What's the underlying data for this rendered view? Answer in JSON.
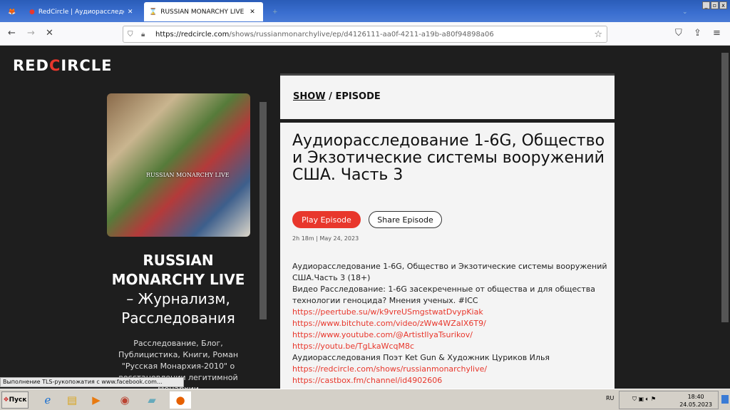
{
  "browser": {
    "tabs": [
      {
        "label": "RedCircle | Аудиорасследование",
        "icon": "redcircle-icon"
      },
      {
        "label": "RUSSIAN MONARCHY LIVE - Журн",
        "icon": "hourglass-icon",
        "active": true
      }
    ],
    "new_tab": "+",
    "url_host": "https://redcircle.com",
    "url_path": "/shows/russianmonarchylive/ep/d4126111-aa0f-4211-a19b-a80f94898a06",
    "status": "Выполнение TLS-рукопожатия с www.facebook.com..."
  },
  "page": {
    "logo_a": "RED",
    "logo_b": "CIRCLE",
    "cover_text": "RUSSIAN MONARCHY LIVE",
    "show_title_bold": "RUSSIAN MONARCHY LIVE",
    "show_title_rest": "– Журнализм, Расследования",
    "show_desc": "Расследование, Блог, Публицистика, Книги, Роман \"Русская Монархия-2010\" о восстановлении легитимной Монархии",
    "crumb_show": "SHOW",
    "crumb_sep": " / ",
    "crumb_episode": "EPISODE",
    "episode_title": "Аудиорасследование 1-6G, Общество и Экзотические системы вооружений США. Часть 3",
    "play_label": "Play Episode",
    "share_label": "Share Episode",
    "meta": "2h 18m | May 24, 2023",
    "desc": [
      {
        "text": "Аудиорасследование 1-6G, Общество и Экзотические системы вооружений США.Часть 3 (18+)"
      },
      {
        "text": "Видео Расследование: 1-6G засекреченные от общества и для общества технологии геноцида? Мнения ученых. #ICC"
      },
      {
        "link": "https://peertube.su/w/k9vreUSmgstwatDvypKiak"
      },
      {
        "link": "https://www.bitchute.com/video/zWw4WZaIX6T9/"
      },
      {
        "link": "https://www.youtube.com/@ArtistIlyaTsurikov/"
      },
      {
        "link": "https://youtu.be/TgLkaWcqM8c"
      },
      {
        "text": "Аудиорасследования Поэт Ket Gun & Художник Цуриков Илья"
      },
      {
        "link": "https://redcircle.com/shows/russianmonarchylive/"
      },
      {
        "link": "https://castbox.fm/channel/id4902606"
      }
    ]
  },
  "taskbar": {
    "start": "Пуск",
    "lang": "RU",
    "time": "18:40",
    "date": "24.05.2023"
  },
  "colors": {
    "accent": "#e8372c",
    "bg": "#1e1e1e",
    "card": "#f4f4f4"
  }
}
